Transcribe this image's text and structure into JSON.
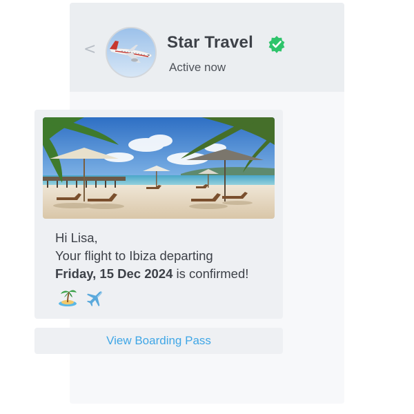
{
  "header": {
    "back_icon": "chevron-left-icon",
    "back_glyph": "<",
    "avatar_icon": "airplane-avatar",
    "name": "Star Travel",
    "verified_icon": "verified-check-icon",
    "status": "Active now"
  },
  "message": {
    "image": "beach-photo",
    "greeting": "Hi Lisa,",
    "line1": "Your flight to Ibiza departing",
    "date": "Friday, 15 Dec 2024",
    "line3_suffix": " is confirmed!",
    "emojis": [
      "island-emoji-icon",
      "airplane-emoji-icon"
    ]
  },
  "action": {
    "label": "View Boarding Pass"
  },
  "colors": {
    "accent": "#3fa6e6",
    "verified": "#2ec46b",
    "header_bg": "#ebeef1",
    "card_bg": "#eef0f3",
    "text": "#3d4148"
  }
}
